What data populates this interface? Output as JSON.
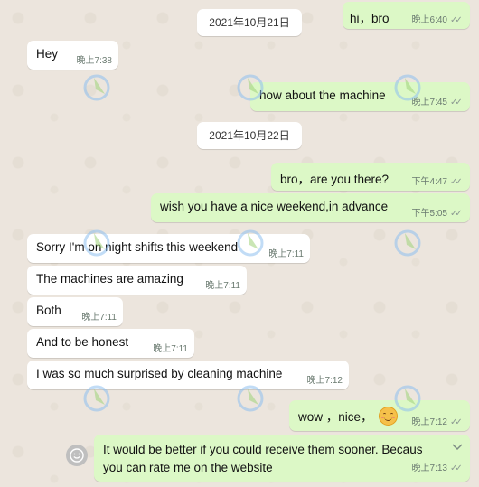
{
  "colors": {
    "incoming": "#ffffff",
    "outgoing": "#dcf8c6",
    "background": "#ece5dd"
  },
  "dates": [
    "2021年10月21日",
    "2021年10月22日"
  ],
  "messages": [
    {
      "dir": "out",
      "text": "hi，bro",
      "time": "晚上6:40",
      "ticks": "✓✓"
    },
    {
      "dir": "in",
      "text": "Hey",
      "time": "晚上7:38"
    },
    {
      "dir": "out",
      "text": "how about the machine",
      "time": "晚上7:45",
      "ticks": "✓✓"
    },
    {
      "dir": "out",
      "text": "bro，are you there?",
      "time": "下午4:47",
      "ticks": "✓✓"
    },
    {
      "dir": "out",
      "text": "wish you have a nice weekend,in advance",
      "time": "下午5:05",
      "ticks": "✓✓"
    },
    {
      "dir": "in",
      "text": "Sorry I'm on night shifts this weekend",
      "time": "晚上7:11"
    },
    {
      "dir": "in",
      "text": "The machines are amazing",
      "time": "晚上7:11"
    },
    {
      "dir": "in",
      "text": "Both",
      "time": "晚上7:11"
    },
    {
      "dir": "in",
      "text": "And to be honest",
      "time": "晚上7:11"
    },
    {
      "dir": "in",
      "text": "I was so much surprised by cleaning machine",
      "time": "晚上7:12"
    },
    {
      "dir": "out",
      "text": "wow ，nice，",
      "time": "晚上7:12",
      "ticks": "✓✓",
      "emoji": "smiling-face-emoji"
    },
    {
      "dir": "out",
      "line1": "It would be better if you could receive them sooner. Becaus",
      "line2": "you can rate me on the website",
      "time": "晚上7:13",
      "ticks": "✓✓"
    }
  ]
}
